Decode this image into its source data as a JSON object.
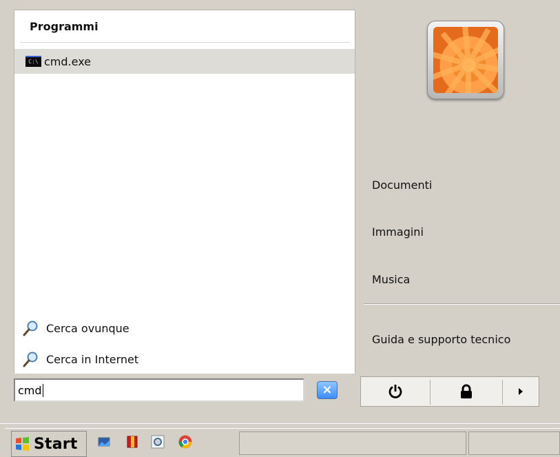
{
  "start_menu": {
    "programs_header": "Programmi",
    "programs": [
      {
        "label": "cmd.exe",
        "icon": "command-prompt-icon",
        "icon_text": "C:\\"
      }
    ],
    "search_links": [
      {
        "label": "Cerca ovunque",
        "icon": "search-icon"
      },
      {
        "label": "Cerca in Internet",
        "icon": "search-icon"
      }
    ],
    "right_links": [
      {
        "label": "Documenti"
      },
      {
        "label": "Immagini"
      },
      {
        "label": "Musica"
      },
      {
        "label": "Guida e supporto tecnico"
      }
    ]
  },
  "search": {
    "value": "cmd",
    "clear_icon": "close-icon"
  },
  "power_buttons": [
    {
      "icon": "power-icon"
    },
    {
      "icon": "lock-icon"
    },
    {
      "icon": "arrow-right-icon"
    }
  ],
  "taskbar": {
    "start_label": "Start",
    "quick_launch_icons": [
      "monitor-icon",
      "book-icon",
      "settings-icon",
      "chrome-icon"
    ]
  },
  "colors": {
    "selected_row": "#dedcd6",
    "menu_background": "#d4d0c8",
    "clear_button": "#3d8bff"
  }
}
